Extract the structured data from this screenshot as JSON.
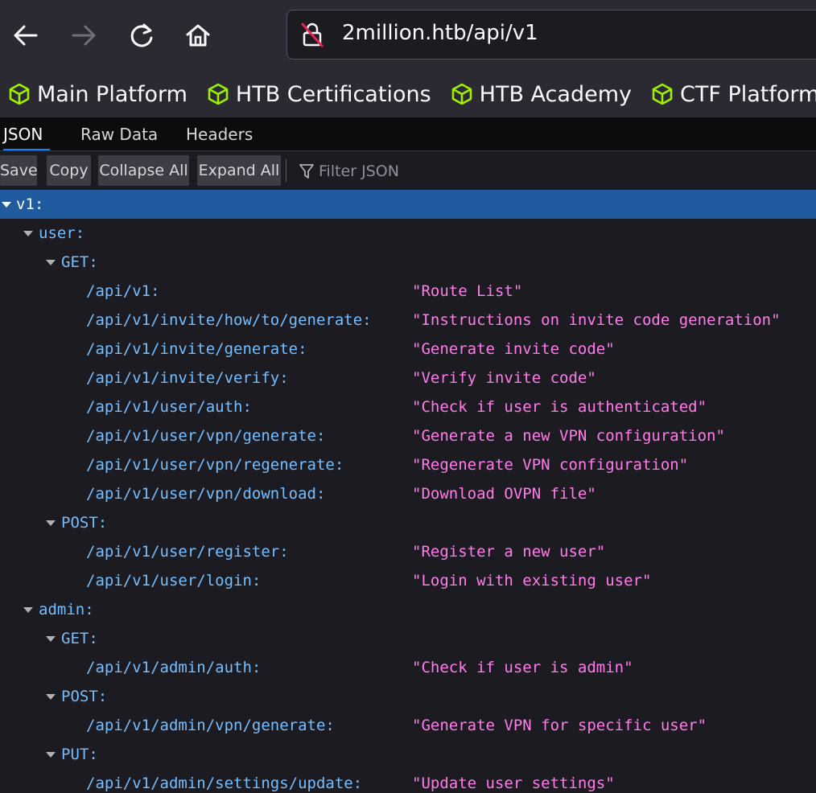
{
  "browser": {
    "url": "2million.htb/api/v1",
    "bookmarks": [
      "Main Platform",
      "HTB Certifications",
      "HTB Academy",
      "CTF Platform"
    ]
  },
  "viewer": {
    "tabs": [
      "JSON",
      "Raw Data",
      "Headers"
    ],
    "toolbar": {
      "save": "Save",
      "copy": "Copy",
      "collapse_all": "Collapse All",
      "expand_all": "Expand All",
      "filter_placeholder": "Filter JSON"
    }
  },
  "tree": {
    "root": "v1:",
    "user": {
      "key": "user:",
      "get": {
        "key": "GET:",
        "entries": [
          {
            "path": "/api/v1:",
            "desc": "\"Route List\""
          },
          {
            "path": "/api/v1/invite/how/to/generate:",
            "desc": "\"Instructions on invite code generation\""
          },
          {
            "path": "/api/v1/invite/generate:",
            "desc": "\"Generate invite code\""
          },
          {
            "path": "/api/v1/invite/verify:",
            "desc": "\"Verify invite code\""
          },
          {
            "path": "/api/v1/user/auth:",
            "desc": "\"Check if user is authenticated\""
          },
          {
            "path": "/api/v1/user/vpn/generate:",
            "desc": "\"Generate a new VPN configuration\""
          },
          {
            "path": "/api/v1/user/vpn/regenerate:",
            "desc": "\"Regenerate VPN configuration\""
          },
          {
            "path": "/api/v1/user/vpn/download:",
            "desc": "\"Download OVPN file\""
          }
        ]
      },
      "post": {
        "key": "POST:",
        "entries": [
          {
            "path": "/api/v1/user/register:",
            "desc": "\"Register a new user\""
          },
          {
            "path": "/api/v1/user/login:",
            "desc": "\"Login with existing user\""
          }
        ]
      }
    },
    "admin": {
      "key": "admin:",
      "get": {
        "key": "GET:",
        "entries": [
          {
            "path": "/api/v1/admin/auth:",
            "desc": "\"Check if user is admin\""
          }
        ]
      },
      "post": {
        "key": "POST:",
        "entries": [
          {
            "path": "/api/v1/admin/vpn/generate:",
            "desc": "\"Generate VPN for specific user\""
          }
        ]
      },
      "put": {
        "key": "PUT:",
        "entries": [
          {
            "path": "/api/v1/admin/settings/update:",
            "desc": "\"Update user settings\""
          }
        ]
      }
    }
  }
}
